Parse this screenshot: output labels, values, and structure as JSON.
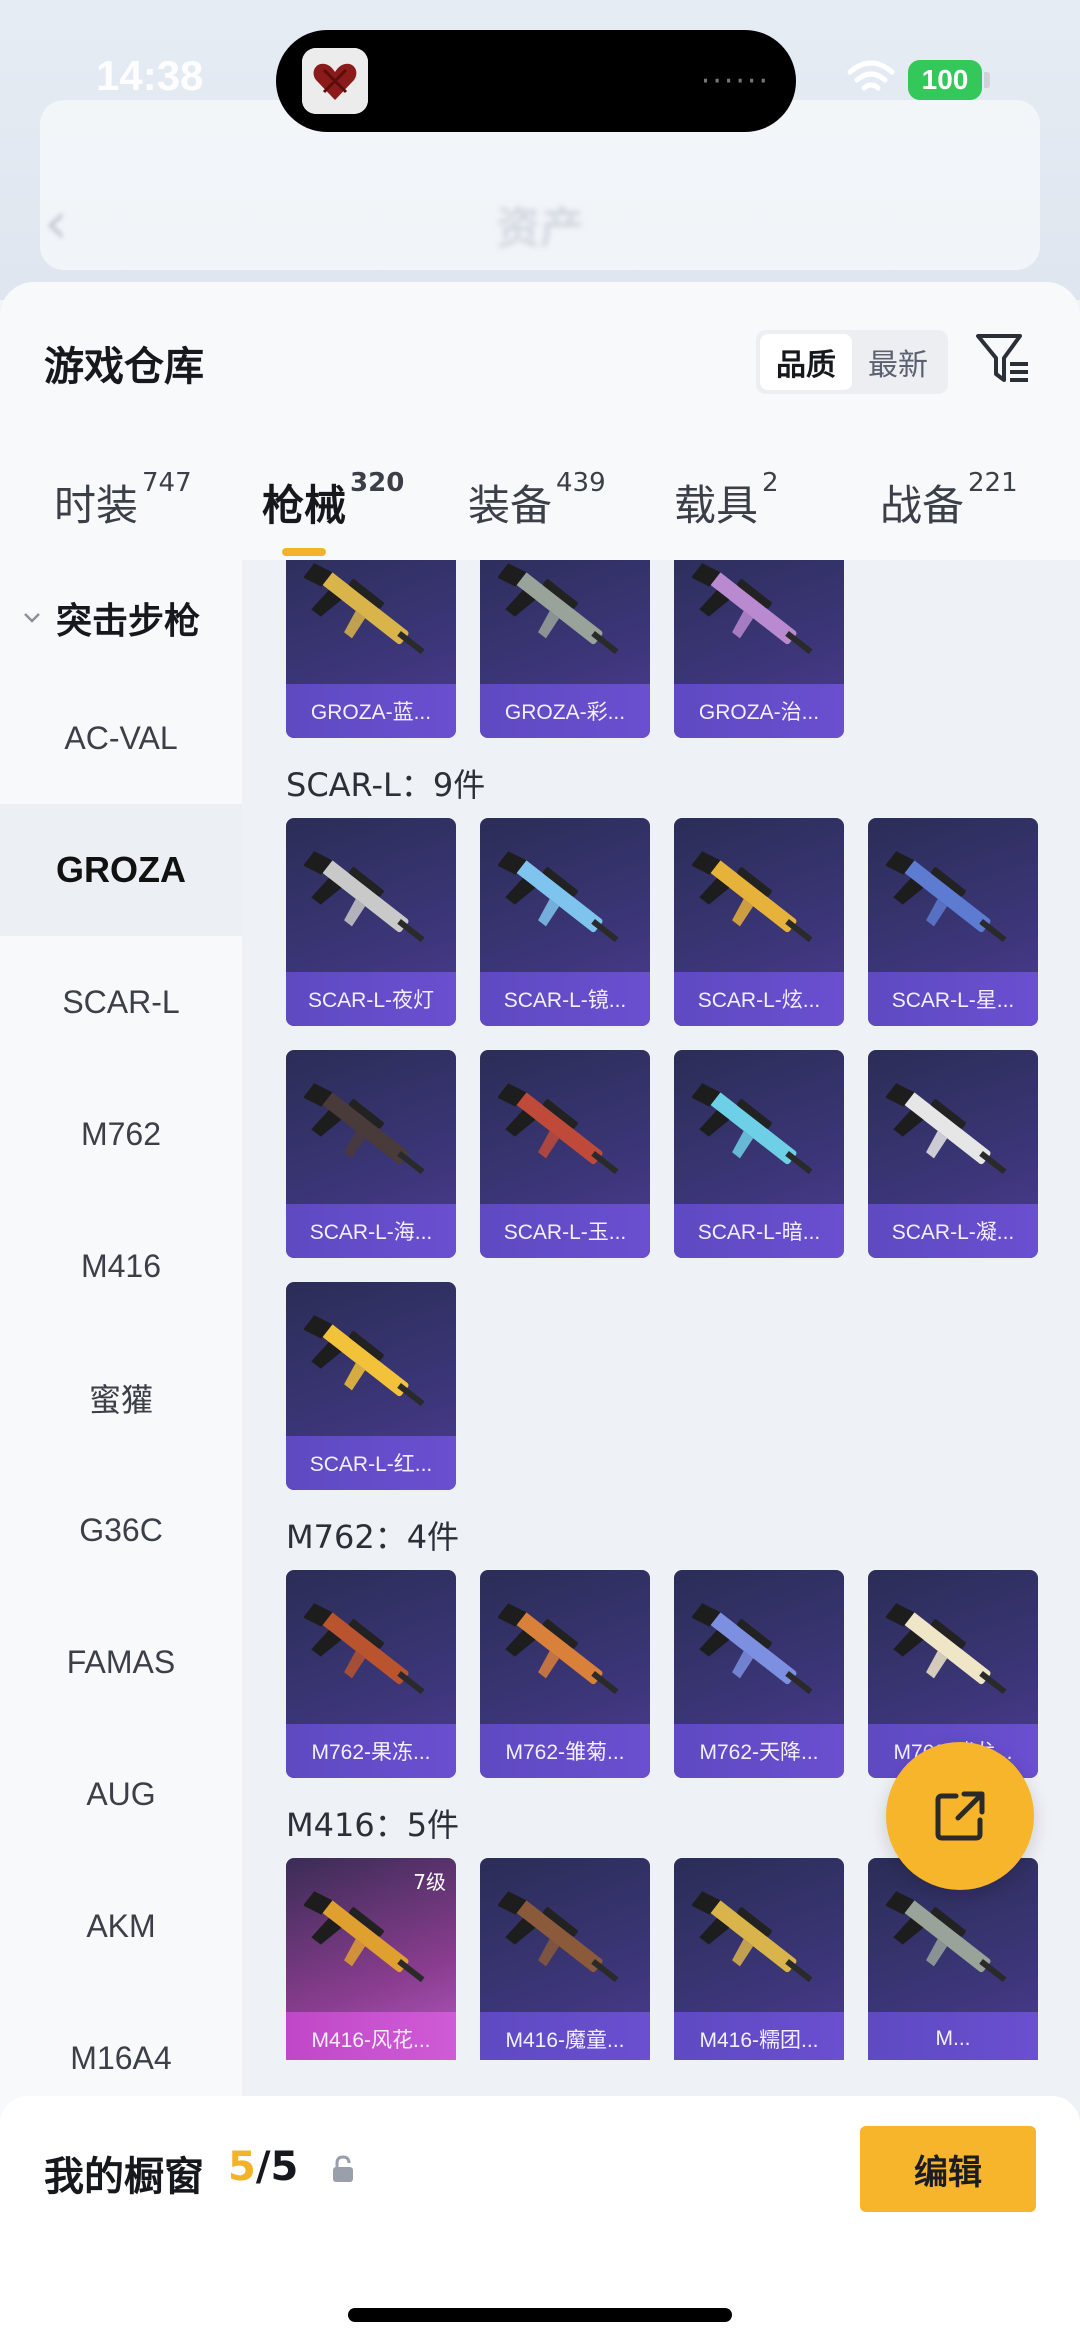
{
  "status_bar": {
    "time": "14:38",
    "battery": "100",
    "dots": "······"
  },
  "background_page": {
    "title": "资产"
  },
  "sheet": {
    "title": "游戏仓库",
    "sort_options": [
      "品质",
      "最新"
    ],
    "active_sort": "品质"
  },
  "tabs": [
    {
      "label": "时装",
      "count": "747"
    },
    {
      "label": "枪械",
      "count": "320"
    },
    {
      "label": "装备",
      "count": "439"
    },
    {
      "label": "载具",
      "count": "2"
    },
    {
      "label": "战备",
      "count": "221"
    }
  ],
  "active_tab": "枪械",
  "sidebar": {
    "group": "突击步枪",
    "items": [
      "AC-VAL",
      "GROZA",
      "SCAR-L",
      "M762",
      "M416",
      "蜜獾",
      "G36C",
      "FAMAS",
      "AUG",
      "AKM",
      "M16A4"
    ],
    "active": "GROZA"
  },
  "sections": [
    {
      "title": "",
      "items": [
        {
          "name": "GROZA-蓝..."
        },
        {
          "name": "GROZA-彩..."
        },
        {
          "name": "GROZA-治..."
        }
      ]
    },
    {
      "title": "SCAR-L：9件",
      "items": [
        {
          "name": "SCAR-L-夜灯"
        },
        {
          "name": "SCAR-L-镜..."
        },
        {
          "name": "SCAR-L-炫..."
        },
        {
          "name": "SCAR-L-星..."
        },
        {
          "name": "SCAR-L-海..."
        },
        {
          "name": "SCAR-L-玉..."
        },
        {
          "name": "SCAR-L-暗..."
        },
        {
          "name": "SCAR-L-凝..."
        },
        {
          "name": "SCAR-L-红..."
        }
      ]
    },
    {
      "title": "M762：4件",
      "items": [
        {
          "name": "M762-果冻..."
        },
        {
          "name": "M762-雏菊..."
        },
        {
          "name": "M762-天降..."
        },
        {
          "name": "M762-瑞龙..."
        }
      ]
    },
    {
      "title": "M416：5件",
      "items": [
        {
          "name": "M416-风花...",
          "badge": "7级"
        },
        {
          "name": "M416-魔童..."
        },
        {
          "name": "M416-糯团..."
        },
        {
          "name": "M..."
        },
        {
          "name": ""
        }
      ]
    }
  ],
  "gun_colors": [
    "#d9b44a",
    "#9aa39a",
    "#b98ad0",
    "#c9c9c9",
    "#7fc4ef",
    "#e7b23a",
    "#5d7bd1",
    "#4a3b3b",
    "#c04a3a",
    "#6ed0e6",
    "#e6e6e6",
    "#f2c23a",
    "#b9542e",
    "#d9803a",
    "#7c8fe0",
    "#efe6c8",
    "#e0a030",
    "#8a5a3a"
  ],
  "bottom_bar": {
    "label": "我的橱窗",
    "current": "5",
    "total": "/5",
    "edit_label": "编辑"
  }
}
